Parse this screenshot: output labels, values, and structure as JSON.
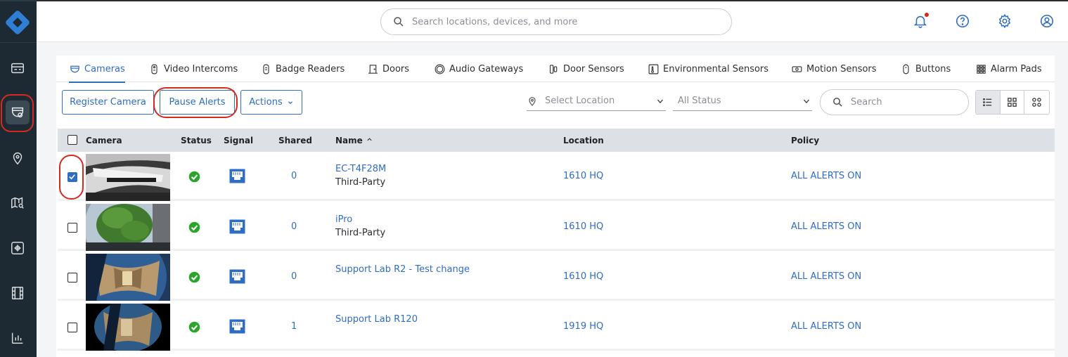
{
  "topbar": {
    "search_placeholder": "Search locations, devices, and more"
  },
  "sidebar": {
    "items": [
      "dashboard",
      "cameras",
      "locations",
      "map",
      "device-hub",
      "video",
      "reports"
    ]
  },
  "tabs": [
    {
      "label": "Cameras",
      "icon": "camera-icon",
      "active": true
    },
    {
      "label": "Video Intercoms",
      "icon": "intercom-icon"
    },
    {
      "label": "Badge Readers",
      "icon": "badge-reader-icon"
    },
    {
      "label": "Doors",
      "icon": "door-icon"
    },
    {
      "label": "Audio Gateways",
      "icon": "audio-gateway-icon"
    },
    {
      "label": "Door Sensors",
      "icon": "door-sensor-icon"
    },
    {
      "label": "Environmental Sensors",
      "icon": "environmental-sensor-icon"
    },
    {
      "label": "Motion Sensors",
      "icon": "motion-sensor-icon"
    },
    {
      "label": "Buttons",
      "icon": "button-device-icon"
    },
    {
      "label": "Alarm Pads",
      "icon": "alarm-pad-icon"
    }
  ],
  "toolbar": {
    "register_label": "Register Camera",
    "pause_label": "Pause Alerts",
    "actions_label": "Actions",
    "location_placeholder": "Select Location",
    "status_placeholder": "All Status",
    "search_placeholder": "Search"
  },
  "table": {
    "headers": {
      "camera": "Camera",
      "status": "Status",
      "signal": "Signal",
      "shared": "Shared",
      "name": "Name",
      "location": "Location",
      "policy": "Policy"
    },
    "rows": [
      {
        "checked": true,
        "shared": "0",
        "name": "EC-T4F28M",
        "sub": "Third-Party",
        "location": "1610 HQ",
        "policy": "ALL ALERTS ON"
      },
      {
        "checked": false,
        "shared": "0",
        "name": "iPro",
        "sub": "Third-Party",
        "location": "1610 HQ",
        "policy": "ALL ALERTS ON"
      },
      {
        "checked": false,
        "shared": "0",
        "name": "Support Lab R2 - Test change",
        "sub": "",
        "location": "1610 HQ",
        "policy": "ALL ALERTS ON"
      },
      {
        "checked": false,
        "shared": "1",
        "name": "Support Lab R120",
        "sub": "",
        "location": "1919 HQ",
        "policy": "ALL ALERTS ON"
      }
    ]
  },
  "colors": {
    "accent": "#2f6cc4",
    "sidebar": "#1e2a33",
    "status_ok": "#2aa52a",
    "highlight": "#d6291f"
  }
}
